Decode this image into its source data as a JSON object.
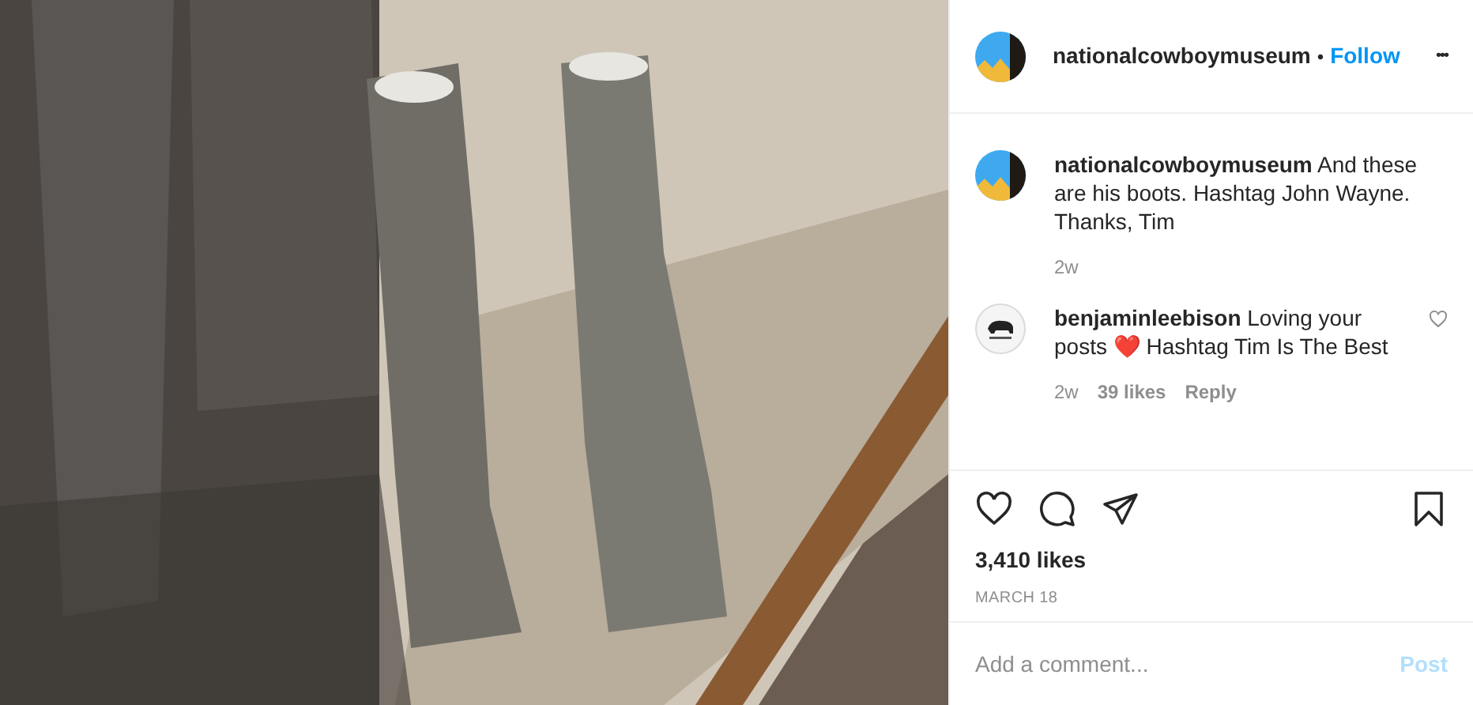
{
  "header": {
    "username": "nationalcowboymuseum",
    "separator": "•",
    "follow": "Follow",
    "more": "•••"
  },
  "comments": [
    {
      "kind": "caption",
      "username": "nationalcowboymuseum",
      "text": "And these are his boots. Hashtag John Wayne. Thanks, Tim",
      "time": "2w"
    },
    {
      "kind": "comment",
      "username": "benjaminleebison",
      "text": "Loving your posts ❤️ Hashtag Tim Is The Best",
      "time": "2w",
      "likes": "39 likes",
      "reply": "Reply",
      "liked": false
    }
  ],
  "likes": "3,410 likes",
  "date": "MARCH 18",
  "comment_box": {
    "placeholder": "Add a comment...",
    "post": "Post",
    "disabled": true
  }
}
